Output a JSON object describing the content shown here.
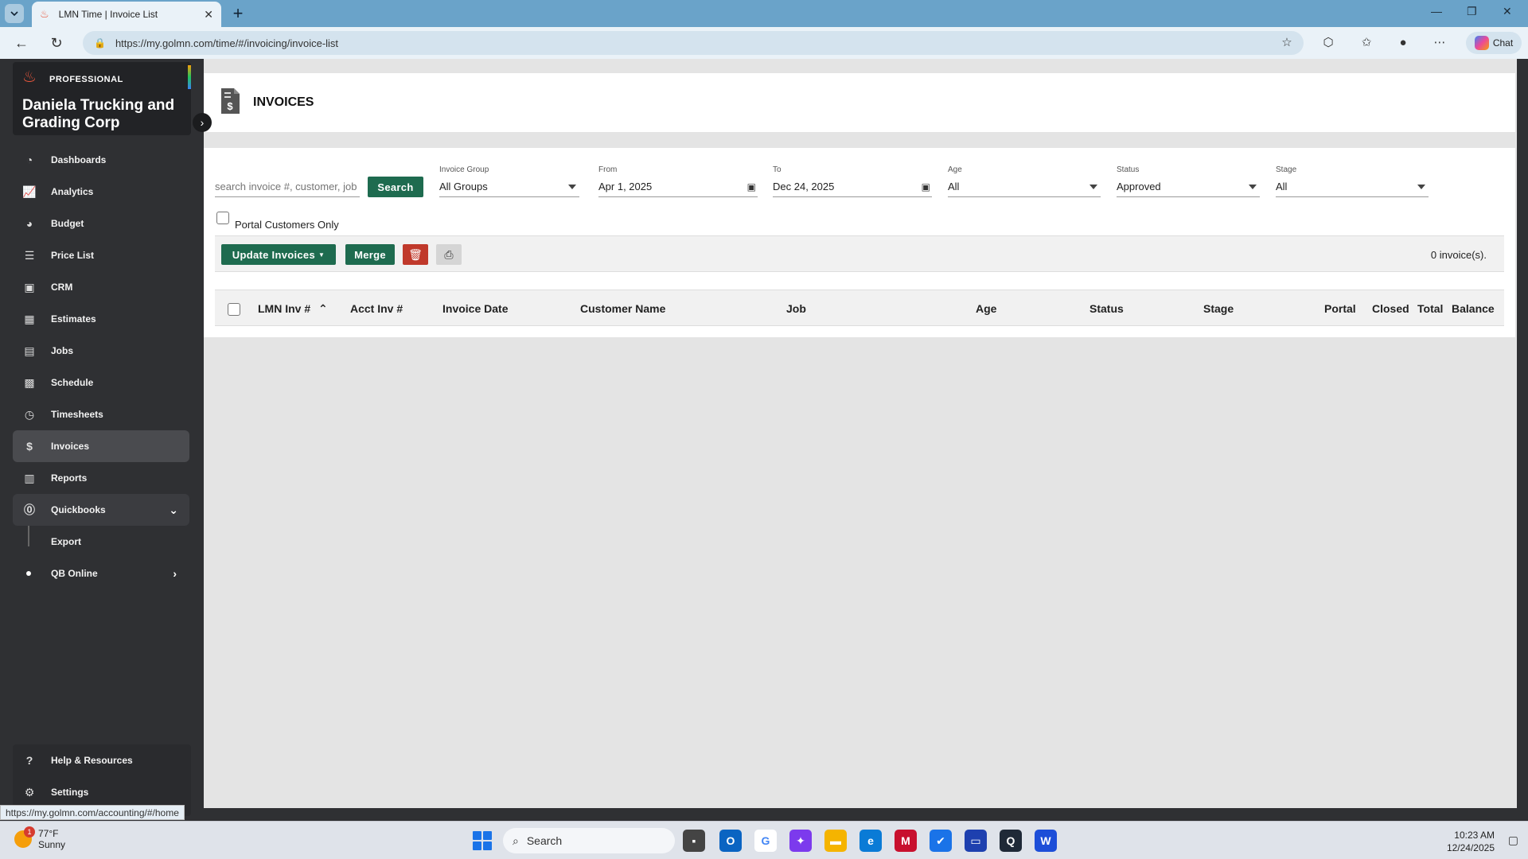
{
  "browser": {
    "tab_title": "LMN Time | Invoice List",
    "url": "https://my.golmn.com/time/#/invoicing/invoice-list",
    "chat_label": "Chat"
  },
  "sidebar": {
    "plan": "PROFESSIONAL",
    "company": "Daniela Trucking and Grading Corp",
    "items": [
      {
        "label": "Dashboards",
        "icon": "dashboard-icon"
      },
      {
        "label": "Analytics",
        "icon": "analytics-icon"
      },
      {
        "label": "Budget",
        "icon": "budget-icon"
      },
      {
        "label": "Price List",
        "icon": "price-list-icon"
      },
      {
        "label": "CRM",
        "icon": "crm-icon"
      },
      {
        "label": "Estimates",
        "icon": "estimates-icon"
      },
      {
        "label": "Jobs",
        "icon": "jobs-icon"
      },
      {
        "label": "Schedule",
        "icon": "schedule-icon"
      },
      {
        "label": "Timesheets",
        "icon": "timesheets-icon"
      },
      {
        "label": "Invoices",
        "icon": "invoices-icon"
      },
      {
        "label": "Reports",
        "icon": "reports-icon"
      },
      {
        "label": "Quickbooks",
        "icon": "quickbooks-icon"
      }
    ],
    "sub_items": [
      {
        "label": "Export"
      },
      {
        "label": "QB Online"
      }
    ],
    "bottom": {
      "help": "Help & Resources",
      "settings": "Settings"
    },
    "status_url": "https://my.golmn.com/accounting/#/home"
  },
  "page": {
    "title": "INVOICES"
  },
  "filters": {
    "search_placeholder": "search invoice #, customer, job",
    "search_button": "Search",
    "invoice_group": {
      "label": "Invoice Group",
      "value": "All Groups"
    },
    "from": {
      "label": "From",
      "value": "Apr 1, 2025"
    },
    "to": {
      "label": "To",
      "value": "Dec 24, 2025"
    },
    "age": {
      "label": "Age",
      "value": "All"
    },
    "status": {
      "label": "Status",
      "value": "Approved"
    },
    "stage": {
      "label": "Stage",
      "value": "All"
    },
    "portal_only": "Portal Customers Only"
  },
  "toolbar": {
    "update_invoices": "Update Invoices",
    "merge": "Merge",
    "count": "0 invoice(s)."
  },
  "table": {
    "columns": [
      "LMN Inv #",
      "Acct Inv #",
      "Invoice Date",
      "Customer Name",
      "Job",
      "Age",
      "Status",
      "Stage",
      "Portal",
      "Closed",
      "Total",
      "Balance"
    ]
  },
  "taskbar": {
    "weather_temp": "77°F",
    "weather_desc": "Sunny",
    "weather_badge": "1",
    "search_label": "Search",
    "time": "10:23 AM",
    "date": "12/24/2025"
  }
}
